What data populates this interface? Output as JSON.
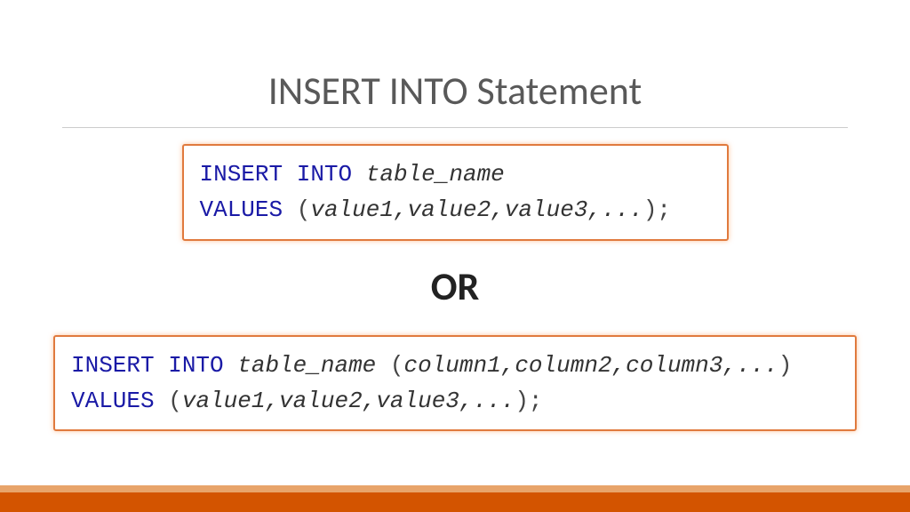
{
  "title": "INSERT INTO Statement",
  "or_label": "OR",
  "code1": {
    "line1_kw1": "INSERT INTO",
    "line1_ident": "table_name",
    "line2_kw": "VALUES",
    "line2_open": " (",
    "line2_vals": "value1,value2,value3,...",
    "line2_close": ");"
  },
  "code2": {
    "line1_kw1": "INSERT INTO",
    "line1_ident": "table_name",
    "line1_open": " (",
    "line1_cols": "column1,column2,column3,...",
    "line1_close": ")",
    "line2_kw": "VALUES",
    "line2_open": " (",
    "line2_vals": "value1,value2,value3,...",
    "line2_close": ");"
  }
}
